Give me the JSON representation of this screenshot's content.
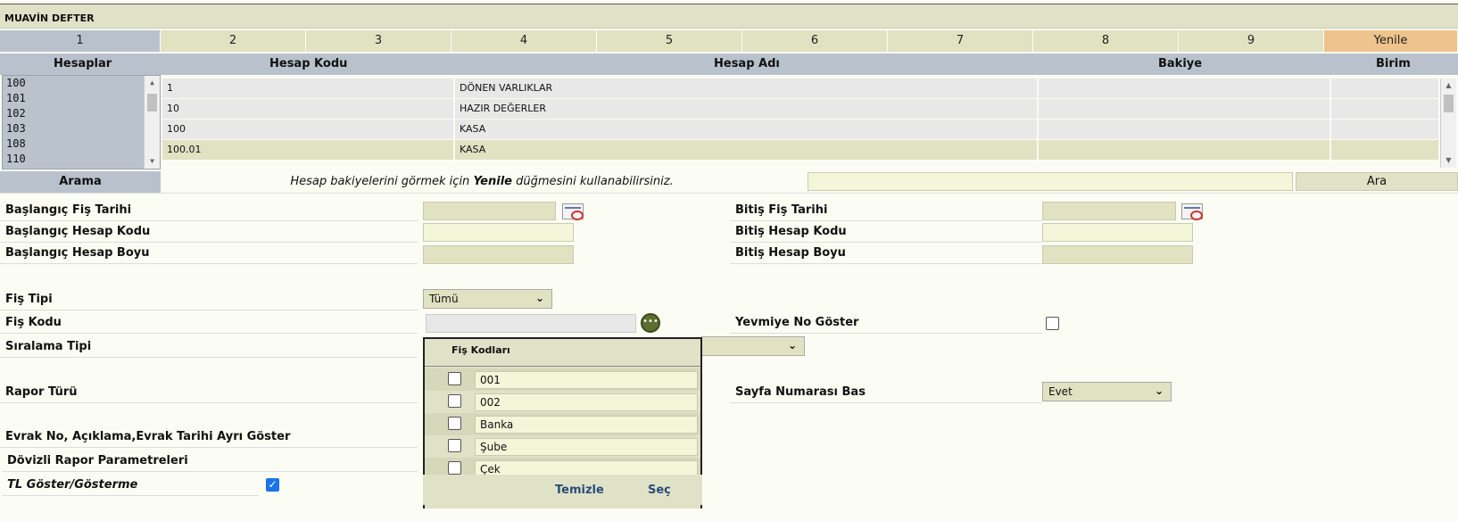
{
  "window": {
    "title": "MUAVİN DEFTER"
  },
  "tabs": [
    {
      "label": "1",
      "active": true
    },
    {
      "label": "2"
    },
    {
      "label": "3"
    },
    {
      "label": "4"
    },
    {
      "label": "5"
    },
    {
      "label": "6"
    },
    {
      "label": "7"
    },
    {
      "label": "8"
    },
    {
      "label": "9"
    },
    {
      "label": "Yenile",
      "refresh": true
    }
  ],
  "columns": {
    "accounts": "Hesaplar",
    "code": "Hesap Kodu",
    "name": "Hesap Adı",
    "balance": "Bakiye",
    "unit": "Birim"
  },
  "accounts_list": [
    "100",
    "101",
    "102",
    "103",
    "108",
    "110"
  ],
  "grid_rows": [
    {
      "code": "1",
      "name": "DÖNEN VARLIKLAR",
      "balance": "",
      "unit": ""
    },
    {
      "code": "10",
      "name": "HAZIR DEĞERLER",
      "balance": "",
      "unit": ""
    },
    {
      "code": "100",
      "name": "KASA",
      "balance": "",
      "unit": ""
    },
    {
      "code": "100.01",
      "name": "KASA",
      "balance": "",
      "unit": "",
      "selected": true
    }
  ],
  "search": {
    "label": "Arama",
    "hint_prefix": "Hesap bakiyelerini görmek için ",
    "hint_bold": "Yenile",
    "hint_suffix": " düğmesini kullanabilirsiniz.",
    "button": "Ara",
    "value": ""
  },
  "form": {
    "start_date_label": "Başlangıç Fiş Tarihi",
    "end_date_label": "Bitiş Fiş Tarihi",
    "start_code_label": "Başlangıç Hesap Kodu",
    "end_code_label": "Bitiş Hesap Kodu",
    "start_length_label": "Başlangıç Hesap Boyu",
    "end_length_label": "Bitiş Hesap Boyu",
    "voucher_type_label": "Fiş Tipi",
    "voucher_type_value": "Tümü",
    "voucher_code_label": "Fiş Kodu",
    "journal_no_label": "Yevmiye No Göster",
    "sort_type_label": "Sıralama Tipi",
    "report_type_label": "Rapor Türü",
    "page_number_label": "Sayfa Numarası Bas",
    "page_number_value": "Evet",
    "doc_separate_label": "Evrak No, Açıklama,Evrak Tarihi Ayrı Göster",
    "currency_params_label": "Dövizli Rapor Parametreleri",
    "tl_show_label": "TL Göster/Gösterme"
  },
  "popup": {
    "title": "Fiş Kodları",
    "items": [
      "001",
      "002",
      "Banka",
      "Şube",
      "Çek"
    ],
    "clear": "Temizle",
    "select": "Seç"
  },
  "colors": {
    "header": "#b9c2cc",
    "refresh": "#efc38d",
    "field": "#e0e2c2",
    "accent": "#1a73e8"
  }
}
